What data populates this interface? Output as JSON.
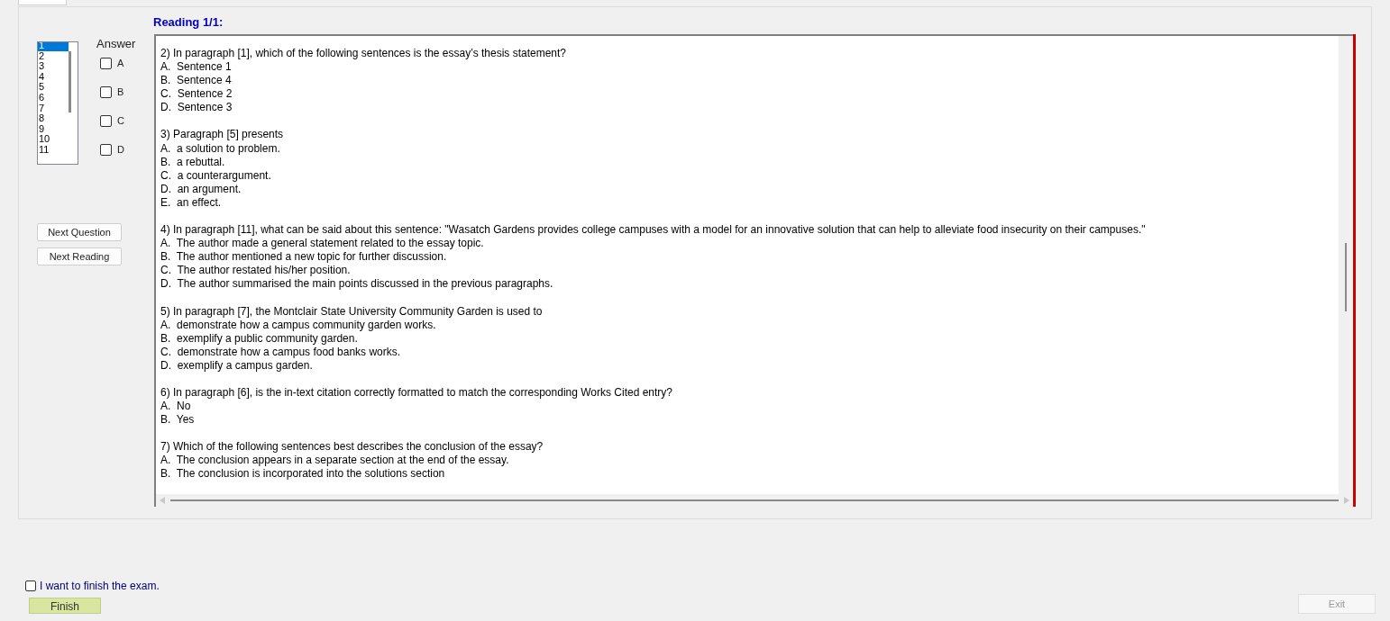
{
  "reading_title": "Reading 1/1:",
  "question_list": [
    {
      "label": "1",
      "selected": true
    },
    {
      "label": "2",
      "selected": false
    },
    {
      "label": "3",
      "selected": false
    },
    {
      "label": "4",
      "selected": false
    },
    {
      "label": "5",
      "selected": false
    },
    {
      "label": "6",
      "selected": false
    },
    {
      "label": "7",
      "selected": false
    },
    {
      "label": "8",
      "selected": false
    },
    {
      "label": "9",
      "selected": false
    },
    {
      "label": "10",
      "selected": false
    },
    {
      "label": "11",
      "selected": false
    }
  ],
  "answer_label": "Answer",
  "answers": [
    {
      "label": "A",
      "checked": false
    },
    {
      "label": "B",
      "checked": false
    },
    {
      "label": "C",
      "checked": false
    },
    {
      "label": "D",
      "checked": false
    }
  ],
  "nav_buttons": [
    "Next Question",
    "Next Reading"
  ],
  "questions": [
    {
      "text": "2) In paragraph [1], which of the following sentences is the essay’s thesis statement?",
      "options": [
        "A.  Sentence 1",
        "B.  Sentence 4",
        "C.  Sentence 2",
        "D.  Sentence 3"
      ]
    },
    {
      "text": "3) Paragraph [5] presents",
      "options": [
        "A.  a solution to problem.",
        "B.  a rebuttal.",
        "C.  a counterargument.",
        "D.  an argument.",
        "E.  an effect."
      ]
    },
    {
      "text": "4) In paragraph [11], what can be said about this sentence: \"Wasatch Gardens provides college campuses with a model for an innovative solution that can help to alleviate food insecurity on their campuses.\"",
      "options": [
        "A.  The author made a general statement related to the essay topic.",
        "B.  The author mentioned a new topic for further discussion.",
        "C.  The author restated his/her position.",
        "D.  The author summarised the main points discussed in the previous paragraphs."
      ]
    },
    {
      "text": "5) In paragraph [7], the Montclair State University Community Garden is used to",
      "options": [
        "A.  demonstrate how a campus community garden works.",
        "B.  exemplify a public community garden.",
        "C.  demonstrate how a campus food banks works.",
        "D.  exemplify a campus garden."
      ]
    },
    {
      "text": "6) In paragraph [6], is the in-text citation correctly formatted to match the corresponding Works Cited entry?",
      "options": [
        "A.  No",
        "B.  Yes"
      ]
    },
    {
      "text": "7) Which of the following sentences best describes the conclusion of the essay?",
      "options": [
        "A.  The conclusion appears in a separate section at the end of the essay.",
        "B.  The conclusion is incorporated into the solutions section"
      ]
    }
  ],
  "finish": {
    "label": "I want to finish the exam.",
    "checked": false
  },
  "finish_button": {
    "label": "Finish"
  },
  "exit_button": {
    "label": "Exit",
    "disabled": true
  }
}
